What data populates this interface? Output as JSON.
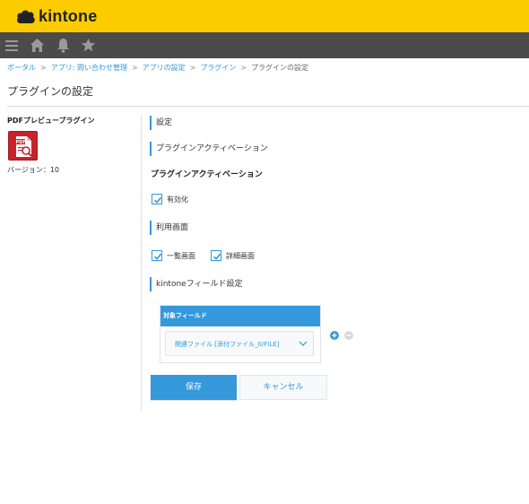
{
  "header": {
    "brand": "kintone",
    "brand_color": "#fccc00",
    "nav_bg": "#4b4b4b",
    "nav_icons": [
      "menu-icon",
      "home-icon",
      "bell-icon",
      "star-icon"
    ]
  },
  "breadcrumb": {
    "items": [
      "ポータル",
      "アプリ: 問い合わせ管理",
      "アプリの設定",
      "プラグイン",
      "プラグインの設定"
    ],
    "separator": ">"
  },
  "page": {
    "title": "プラグインの設定"
  },
  "plugin": {
    "name": "PDFプレビュープラグイン",
    "icon_text": "PDF",
    "version_label": "バージョン：10"
  },
  "settings": {
    "section_title": "設定",
    "activation_section": "プラグインアクティベーション",
    "activation_subtitle": "プラグインアクティベーション",
    "enabled_label": "有効化",
    "enabled_checked": true,
    "screens_section": "利用画面",
    "screens": [
      {
        "label": "一覧画面",
        "checked": true
      },
      {
        "label": "詳細画面",
        "checked": true
      }
    ],
    "field_section": "kintoneフィールド設定",
    "table_header": "対象フィールド",
    "selected_field": "関連ファイル [添付ファイル_0/FILE]"
  },
  "buttons": {
    "save": "保存",
    "cancel": "キャンセル"
  },
  "colors": {
    "accent": "#3498db",
    "plugin_red": "#c8232c"
  }
}
